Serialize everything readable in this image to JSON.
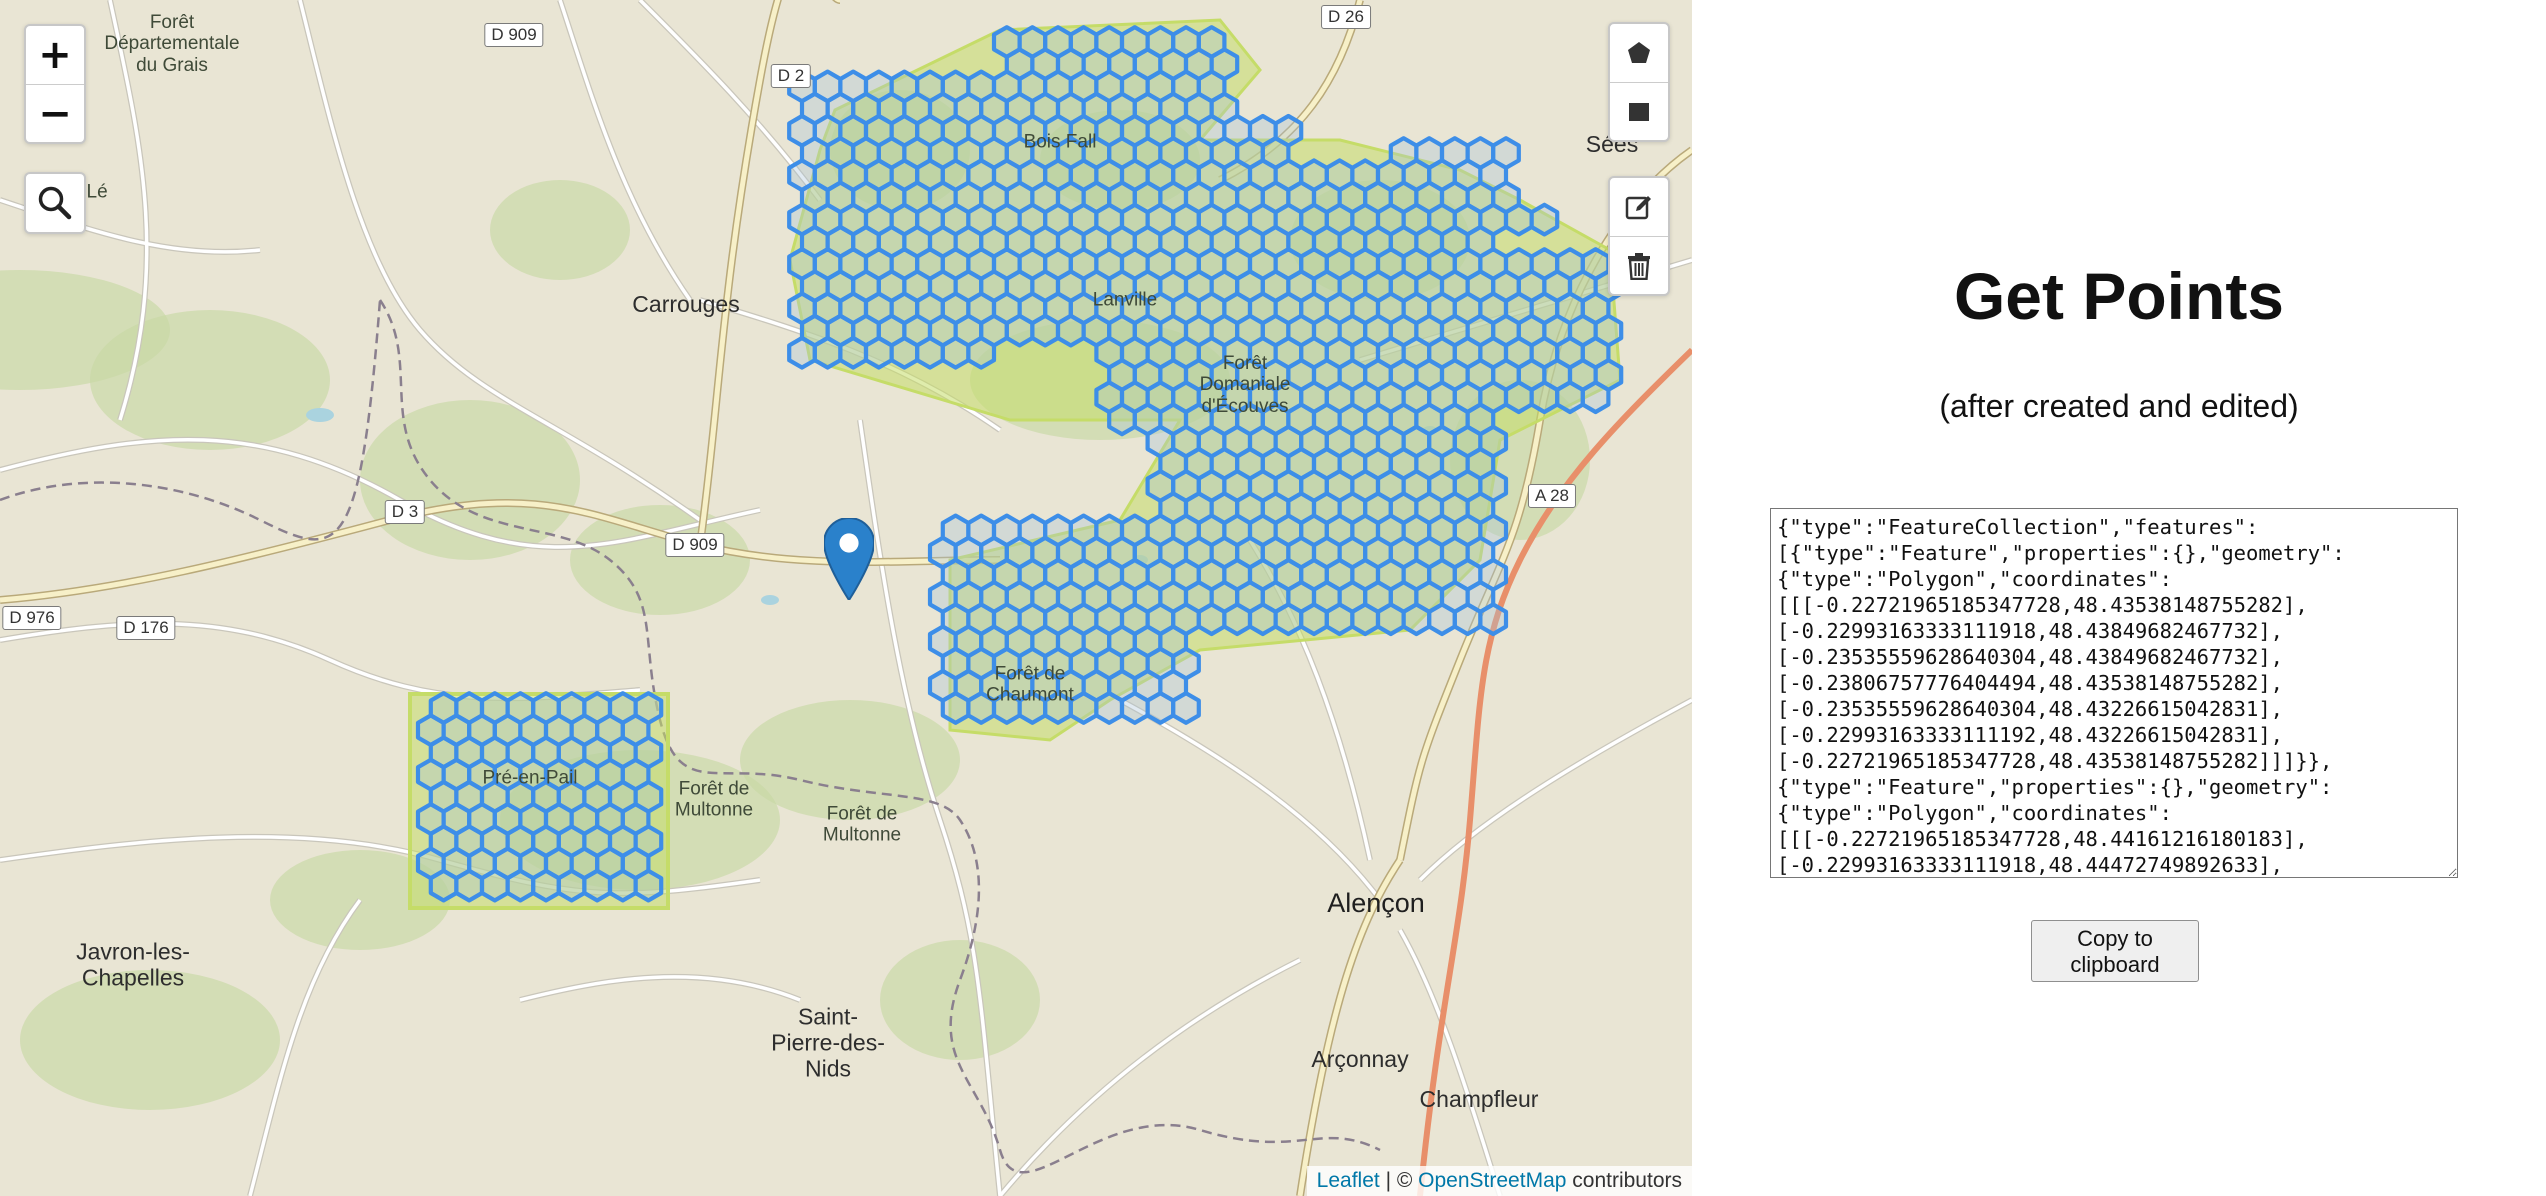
{
  "map": {
    "place_labels": [
      {
        "id": "foret-grais",
        "text": "Forêt\nDépartementale\ndu Grais",
        "kind": "forest"
      },
      {
        "id": "carrouges",
        "text": "Carrouges",
        "kind": "town"
      },
      {
        "id": "sees",
        "text": "Sées",
        "kind": "town"
      },
      {
        "id": "bois-l",
        "text": "Bois Lé\nté",
        "kind": "forest"
      },
      {
        "id": "bois-fall",
        "text": "Bois Fall",
        "kind": "forest"
      },
      {
        "id": "lanville",
        "text": "Lanville",
        "kind": "forest"
      },
      {
        "id": "foret-ecouves",
        "text": "Forêt\nDomaniale\nd'Écouves",
        "kind": "forest"
      },
      {
        "id": "foret-chaumont",
        "text": "Forêt de\nChaumont",
        "kind": "forest"
      },
      {
        "id": "pre-en-pail",
        "text": "Pré-en-Pail",
        "kind": "forest"
      },
      {
        "id": "foret-multonne-1",
        "text": "Forêt de\nMultonne",
        "kind": "forest"
      },
      {
        "id": "foret-multonne-2",
        "text": "Forêt de\nMultonne",
        "kind": "forest"
      },
      {
        "id": "alencon",
        "text": "Alençon",
        "kind": "city"
      },
      {
        "id": "javron",
        "text": "Javron-les-\nChapelles",
        "kind": "town"
      },
      {
        "id": "saint-pierre",
        "text": "Saint-\nPierre-des-\nNids",
        "kind": "town"
      },
      {
        "id": "arconnay",
        "text": "Arçonnay",
        "kind": "town"
      },
      {
        "id": "champfleur",
        "text": "Champfleur",
        "kind": "town"
      }
    ],
    "road_labels": [
      "D 909",
      "D 2",
      "D 26",
      "D 3",
      "D 909",
      "D 976",
      "D 176",
      "A 28"
    ],
    "zoom_in_label": "+",
    "zoom_out_label": "−",
    "attribution": {
      "leaflet": "Leaflet",
      "separator": " | © ",
      "osm": "OpenStreetMap",
      "suffix": " contributors"
    },
    "colors": {
      "hex_stroke": "#3d8ee8",
      "hex_fill": "#a9c3d8",
      "drawn_polygon": "#c5dc68",
      "water": "#aad3df",
      "forest": "#c8d8a4",
      "marker": "#2a81cb"
    },
    "icons": [
      "search-icon",
      "polygon-icon",
      "rectangle-icon",
      "edit-icon",
      "trash-icon",
      "map-marker-icon"
    ]
  },
  "panel": {
    "title": "Get Points",
    "subtitle": "(after created and edited)",
    "geojson_text": "{\"type\":\"FeatureCollection\",\"features\":\n[{\"type\":\"Feature\",\"properties\":{},\"geometry\":\n{\"type\":\"Polygon\",\"coordinates\":\n[[[-0.22721965185347728,48.43538148755282],\n[-0.22993163333111918,48.43849682467732],\n[-0.23535559628640304,48.43849682467732],\n[-0.23806757776404494,48.43538148755282],\n[-0.23535559628640304,48.43226615042831],\n[-0.22993163333111192,48.43226615042831],\n[-0.22721965185347728,48.43538148755282]]]}},\n{\"type\":\"Feature\",\"properties\":{},\"geometry\":\n{\"type\":\"Polygon\",\"coordinates\":\n[[[-0.22721965185347728,48.44161216180183],\n[-0.22993163333111918,48.44472749892633],",
    "copy_button_label": "Copy to\nclipboard"
  }
}
